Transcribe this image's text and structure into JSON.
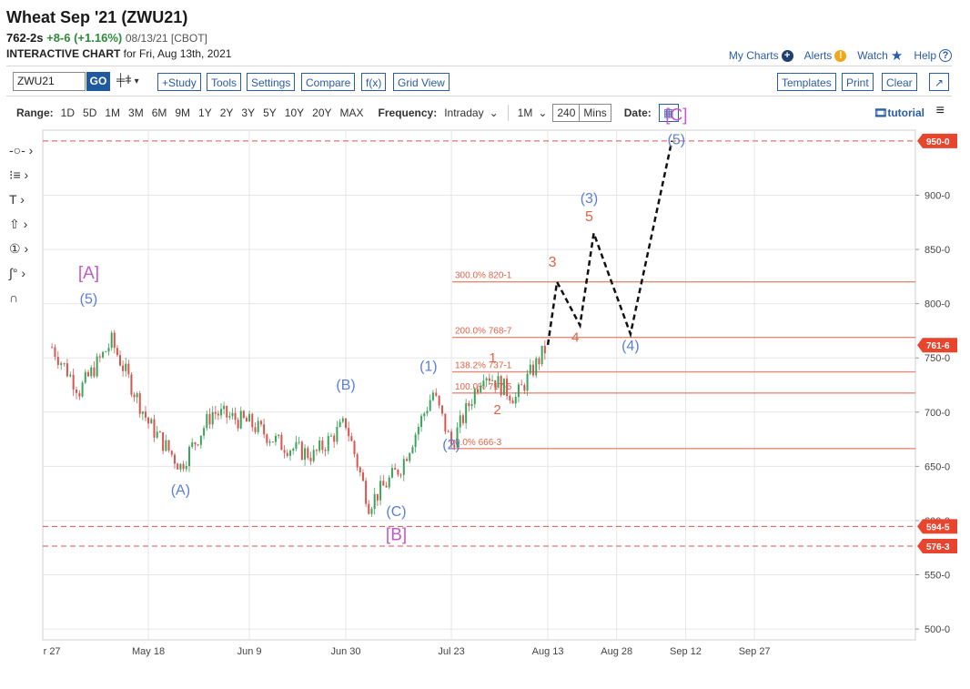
{
  "header": {
    "title": "Wheat Sep '21 (ZWU21)",
    "last_price": "762-2s",
    "change": "+8-6 (+1.16%)",
    "date_exchange": "08/13/21 [CBOT]",
    "subtitle_bold": "INTERACTIVE CHART",
    "subtitle_rest": " for Fri, Aug 13th, 2021"
  },
  "toplinks": {
    "my_charts": "My Charts",
    "alerts": "Alerts",
    "watch": "Watch",
    "help": "Help"
  },
  "toolbar": {
    "symbol": "ZWU21",
    "go": "GO",
    "study": "+Study",
    "tools": "Tools",
    "settings": "Settings",
    "compare": "Compare",
    "fx": "f(x)",
    "grid_view": "Grid View",
    "templates": "Templates",
    "print": "Print",
    "clear": "Clear"
  },
  "rangebar": {
    "range_label": "Range:",
    "ranges": [
      "1D",
      "5D",
      "1M",
      "3M",
      "6M",
      "9M",
      "1Y",
      "2Y",
      "3Y",
      "5Y",
      "10Y",
      "20Y",
      "MAX"
    ],
    "frequency_label": "Frequency:",
    "frequency": "Intraday",
    "interval": "1M",
    "minutes": "240",
    "minutes_unit": "Mins",
    "date_label": "Date:",
    "tutorial": "tutorial"
  },
  "colors": {
    "accent": "#2a5ca8",
    "up": "#3aa55a",
    "down": "#d9534f",
    "fib": "#e0634a",
    "wave_blue": "#5b7fd6",
    "wave_purple": "#c45ac9",
    "tag_red": "#e8452f"
  },
  "chart_data": {
    "type": "candlestick",
    "ylim": [
      490,
      960
    ],
    "yticks": [
      "500-0",
      "550-0",
      "600-0",
      "650-0",
      "700-0",
      "750-0",
      "800-0",
      "850-0",
      "900-0"
    ],
    "ytick_values": [
      500,
      550,
      600,
      650,
      700,
      750,
      800,
      850,
      900
    ],
    "xticks": [
      "r 27",
      "May 18",
      "Jun 9",
      "Jun 30",
      "Jul 23",
      "Aug 13",
      "Aug 28",
      "Sep 12",
      "Sep 27"
    ],
    "price_tags": [
      {
        "label": "950-0",
        "value": 950
      },
      {
        "label": "761-6",
        "value": 761.75
      },
      {
        "label": "594-5",
        "value": 594.6
      },
      {
        "label": "576-3",
        "value": 576.4
      }
    ],
    "horizontal_dashed": [
      950,
      594.6,
      576.4
    ],
    "fib_levels": [
      {
        "label": "300.0% 820-1",
        "value": 820.1
      },
      {
        "label": "200.0% 768-7",
        "value": 768.9
      },
      {
        "label": "138.2% 737-1",
        "value": 737.1
      },
      {
        "label": "100.0% 717-5",
        "value": 717.6
      },
      {
        "label": "0.0% 666-3",
        "value": 666.4
      }
    ],
    "series": [
      {
        "date": "Apr 27",
        "price": 760
      },
      {
        "date": "May 3",
        "price": 720
      },
      {
        "date": "May 10",
        "price": 765
      },
      {
        "date": "May 18",
        "price": 690
      },
      {
        "date": "May 25",
        "price": 650
      },
      {
        "date": "Jun 1",
        "price": 700
      },
      {
        "date": "Jun 9",
        "price": 690
      },
      {
        "date": "Jun 16",
        "price": 670
      },
      {
        "date": "Jun 23",
        "price": 660
      },
      {
        "date": "Jun 30",
        "price": 690
      },
      {
        "date": "Jul 5",
        "price": 615
      },
      {
        "date": "Jul 12",
        "price": 650
      },
      {
        "date": "Jul 19",
        "price": 718
      },
      {
        "date": "Jul 23",
        "price": 670
      },
      {
        "date": "Jul 30",
        "price": 738
      },
      {
        "date": "Aug 6",
        "price": 713
      },
      {
        "date": "Aug 13",
        "price": 762
      }
    ],
    "projection": [
      {
        "date": "Aug 13",
        "price": 762
      },
      {
        "date": "Aug 15",
        "price": 820
      },
      {
        "date": "Aug 20",
        "price": 780
      },
      {
        "date": "Aug 23",
        "price": 865
      },
      {
        "date": "Aug 31",
        "price": 772
      },
      {
        "date": "Sep 9",
        "price": 950
      }
    ],
    "wave_labels": [
      {
        "text": "[A]",
        "color": "purple"
      },
      {
        "text": "(5)",
        "color": "blue"
      },
      {
        "text": "(A)",
        "color": "blue"
      },
      {
        "text": "(B)",
        "color": "blue"
      },
      {
        "text": "(C)",
        "color": "blue"
      },
      {
        "text": "[B]",
        "color": "purple"
      },
      {
        "text": "(1)",
        "color": "blue"
      },
      {
        "text": "(2)",
        "color": "blue"
      },
      {
        "text": "1",
        "color": "red"
      },
      {
        "text": "2",
        "color": "red"
      },
      {
        "text": "3",
        "color": "red"
      },
      {
        "text": "4",
        "color": "red"
      },
      {
        "text": "(3)",
        "color": "blue"
      },
      {
        "text": "5",
        "color": "red"
      },
      {
        "text": "(4)",
        "color": "blue"
      },
      {
        "text": "[C]",
        "color": "purple"
      },
      {
        "text": "(5)",
        "color": "blue"
      }
    ]
  }
}
